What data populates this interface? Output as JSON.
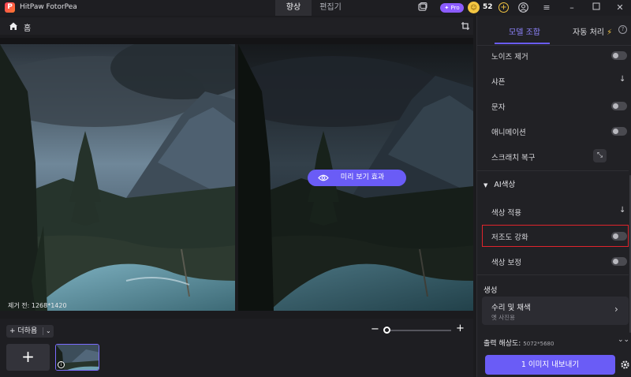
{
  "app": {
    "title": "HitPaw FotorPea",
    "logo_letter": "P",
    "tabs": [
      {
        "label": "향상",
        "active": true
      },
      {
        "label": "편집기",
        "active": false
      }
    ],
    "pro_label": "Pro",
    "coins": "52",
    "icons": [
      "gallery-icon",
      "coin-icon",
      "add-coin-icon",
      "user-icon",
      "menu-icon",
      "minimize-icon",
      "maximize-icon",
      "close-icon"
    ]
  },
  "toolbar": {
    "home_label": "홈"
  },
  "viewer": {
    "size_label": "제거 전: 1268*1420",
    "preview_button": "미리 보기 효과"
  },
  "bottom": {
    "add_more_label": "+ 더하욤",
    "add_tile": "+"
  },
  "panel": {
    "tabs": [
      {
        "label": "모델 조합",
        "active": true
      },
      {
        "label": "자동 처리",
        "active": false
      }
    ],
    "rows": [
      {
        "label": "노이즈 제거",
        "control": "toggle",
        "on": false
      },
      {
        "label": "샤픈",
        "control": "download"
      },
      {
        "label": "문자",
        "control": "toggle",
        "on": false
      },
      {
        "label": "애니메이션",
        "control": "toggle",
        "on": false
      },
      {
        "label": "스크래치 복구",
        "control": "button"
      }
    ],
    "ai_color_section": "AI색상",
    "ai_rows": [
      {
        "label": "색상 적용",
        "control": "download"
      },
      {
        "label": "저조도 강화",
        "control": "toggle",
        "on": false,
        "highlighted": true
      },
      {
        "label": "색상 보정",
        "control": "toggle",
        "on": false
      }
    ],
    "generate_section": "생성",
    "card": {
      "title": "수리 및 채색",
      "subtitle": "옛 사진용"
    },
    "output_label": "출력 해상도:",
    "output_resolution": "5072*5680",
    "export_button": "1 이미지 내보내기"
  },
  "colors": {
    "accent": "#6a5cf6",
    "highlight": "#e0242c",
    "background": "#1b1b1e",
    "panel": "#212125"
  }
}
